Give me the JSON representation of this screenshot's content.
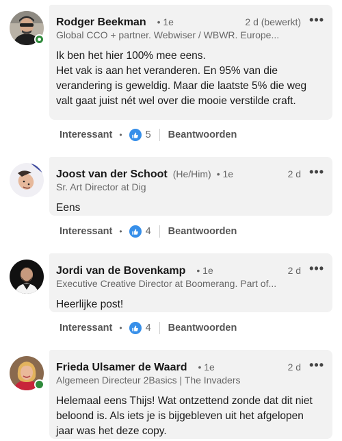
{
  "comments": [
    {
      "name": "Rodger Beekman",
      "pronoun": "",
      "degree": "• 1e",
      "time": "2 d (bewerkt)",
      "more": "•••",
      "headline": "Global CCO + partner. Webwiser / WBWR. Europe...",
      "body": "Ik ben het hier 100% mee eens.\nHet vak is aan het veranderen. En 95% van die verandering is geweldig. Maar die laatste 5% die weg valt gaat juist nét wel over die mooie verstilde craft.",
      "react_label": "Interessant",
      "like_count": "5",
      "reply_label": "Beantwoorden",
      "avatar_icon": "profile-photo",
      "online": true
    },
    {
      "name": "Joost van der Schoot",
      "pronoun": "(He/Him)",
      "degree": "• 1e",
      "time": "2 d",
      "more": "•••",
      "headline": "Sr. Art Director at Dig",
      "body": "Eens",
      "react_label": "Interessant",
      "like_count": "4",
      "reply_label": "Beantwoorden",
      "avatar_icon": "profile-photo",
      "online": false
    },
    {
      "name": "Jordi van de Bovenkamp",
      "pronoun": "",
      "degree": "• 1e",
      "time": "2 d",
      "more": "•••",
      "headline": "Executive Creative Director at Boomerang. Part of...",
      "body": "Heerlijke post!",
      "react_label": "Interessant",
      "like_count": "4",
      "reply_label": "Beantwoorden",
      "avatar_icon": "profile-photo",
      "online": false
    },
    {
      "name": "Frieda Ulsamer de Waard",
      "pronoun": "",
      "degree": "• 1e",
      "time": "2 d",
      "more": "•••",
      "headline": "Algemeen Directeur 2Basics | The Invaders",
      "body": "Helemaal eens Thijs! Wat ontzettend zonde dat dit niet beloond is. Als iets je is bijgebleven uit het afgelopen jaar was het deze copy.",
      "avatar_icon": "profile-photo",
      "online": true
    }
  ],
  "separator": "•",
  "colors": {
    "bubble": "#f2f2f2",
    "like_blue": "#378fe9",
    "online_green": "#2f8a3b"
  }
}
